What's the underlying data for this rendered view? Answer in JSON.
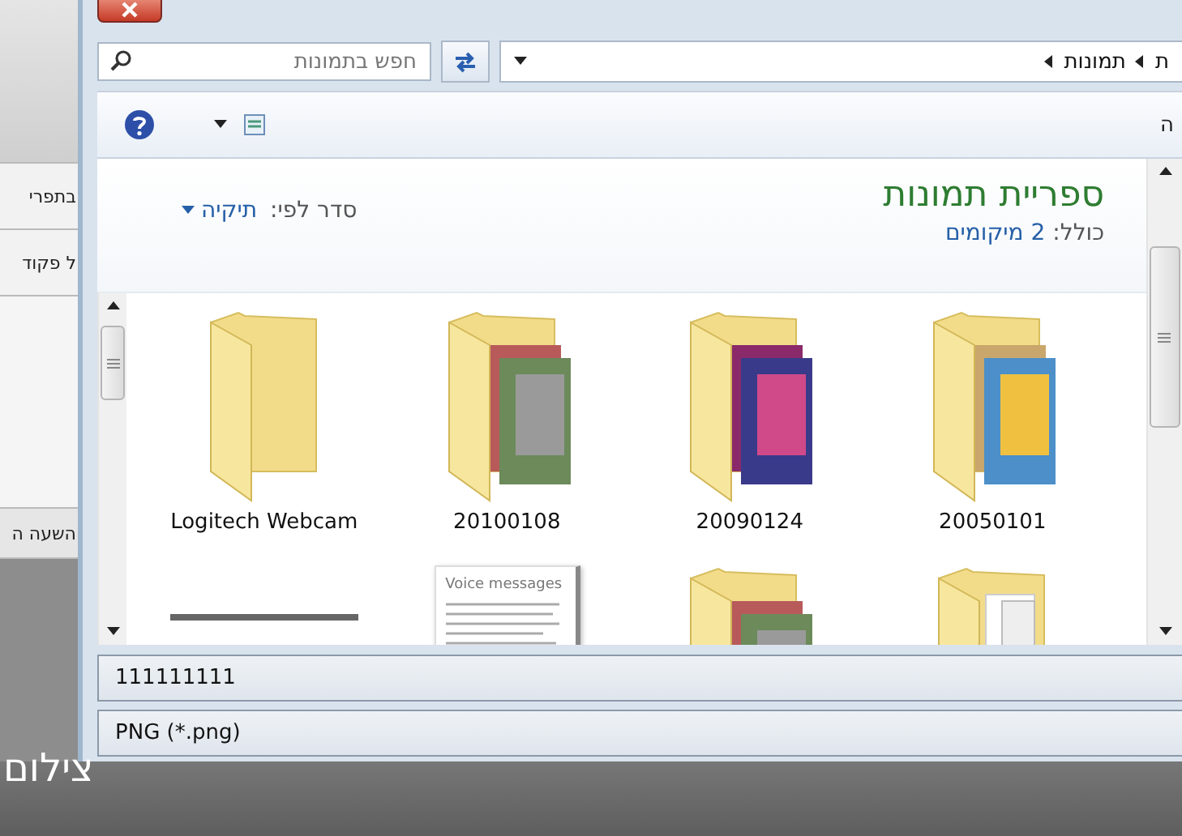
{
  "background_window": {
    "texts": [
      "בתפרי",
      "ל פקוד",
      "השעה ה"
    ],
    "caption": "צילום"
  },
  "dialog": {
    "breadcrumb": [
      {
        "label": "ת"
      },
      {
        "label": "תמונות"
      }
    ],
    "search": {
      "placeholder": "חפש בתמונות"
    },
    "toolbar": {
      "cut_label": "ה"
    },
    "library": {
      "title": "ספריית תמונות",
      "includes_label": "כולל:",
      "includes_link": "2 מיקומים",
      "sort_label": "סדר לפי:",
      "sort_value": "תיקיה"
    },
    "items": [
      {
        "label": "20050101",
        "kind": "photo-folder"
      },
      {
        "label": "20090124",
        "kind": "photo-folder"
      },
      {
        "label": "20100108",
        "kind": "photo-folder"
      },
      {
        "label": "Logitech Webcam",
        "kind": "folder"
      },
      {
        "kind": "papers-folder"
      },
      {
        "kind": "photo-folder"
      },
      {
        "kind": "document",
        "doc_title": "Voice messages"
      },
      {
        "kind": "partial"
      }
    ],
    "file_name": "111111111",
    "file_type": "PNG (*.png)"
  }
}
